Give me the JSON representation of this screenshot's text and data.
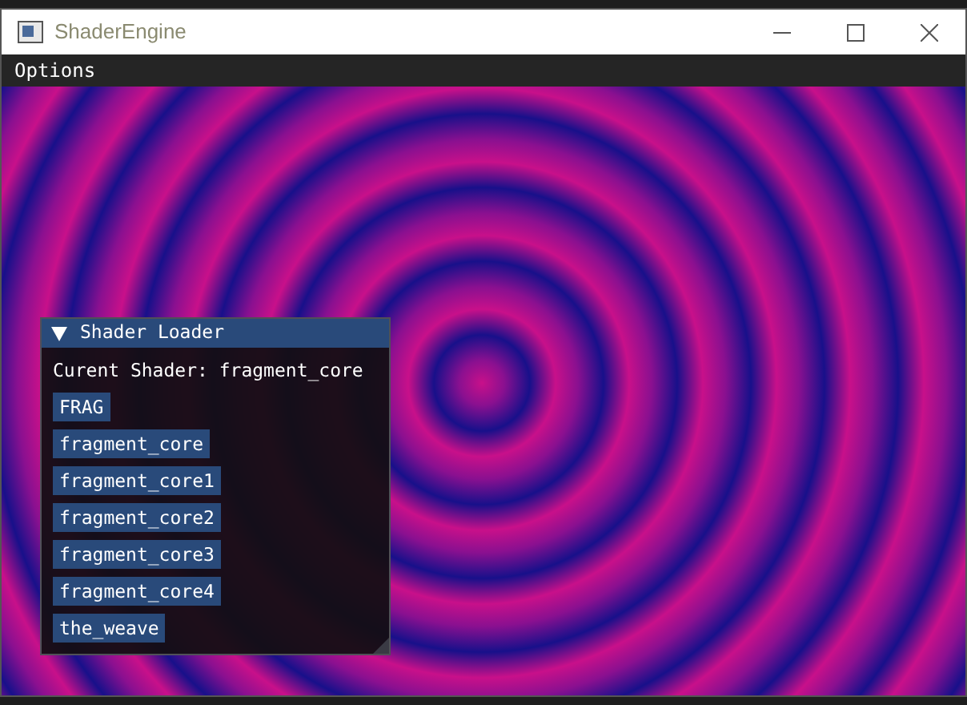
{
  "window": {
    "title": "ShaderEngine"
  },
  "menu_bar": [
    {
      "label": "Options"
    }
  ],
  "panel": {
    "title": "Shader Loader",
    "expanded": true,
    "current_shader": "Curent Shader: fragment_core",
    "buttons": [
      {
        "label": "FRAG"
      },
      {
        "label": "fragment_core"
      },
      {
        "label": "fragment_core1"
      },
      {
        "label": "fragment_core2"
      },
      {
        "label": "fragment_core3"
      },
      {
        "label": "fragment_core4"
      },
      {
        "label": "the_weave"
      }
    ]
  }
}
